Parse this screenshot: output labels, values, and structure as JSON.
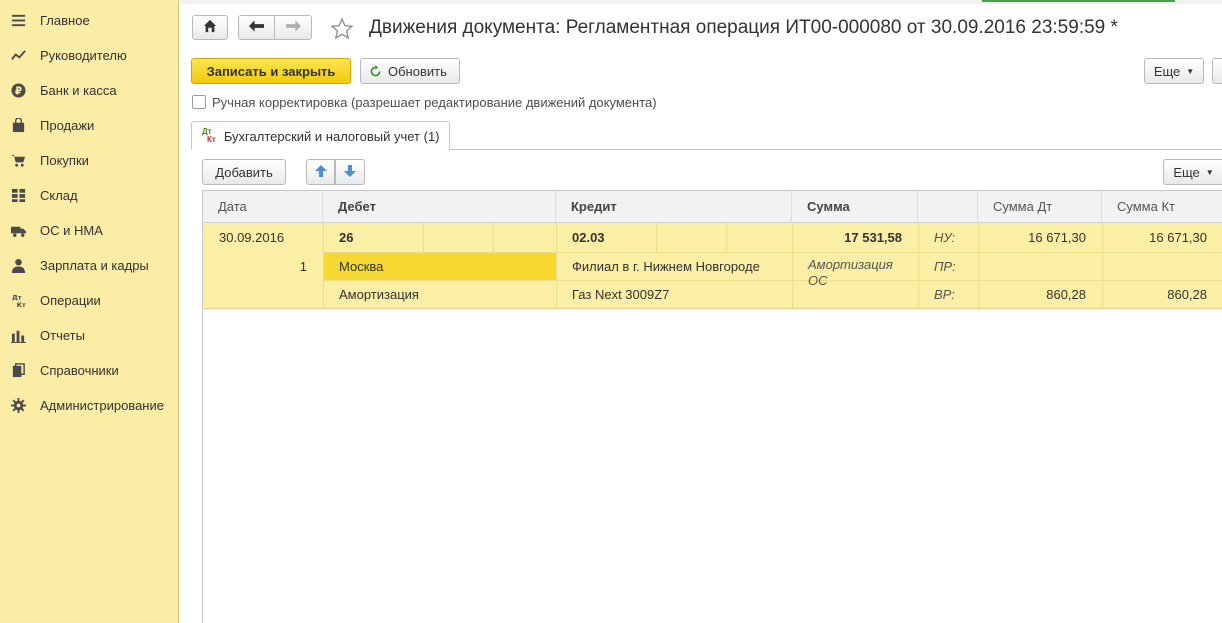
{
  "sidebar": {
    "items": [
      {
        "label": "Главное",
        "icon": "menu-icon"
      },
      {
        "label": "Руководителю",
        "icon": "trend-icon"
      },
      {
        "label": "Банк и касса",
        "icon": "ruble-icon"
      },
      {
        "label": "Продажи",
        "icon": "bag-icon"
      },
      {
        "label": "Покупки",
        "icon": "cart-icon"
      },
      {
        "label": "Склад",
        "icon": "grid-icon"
      },
      {
        "label": "ОС и НМА",
        "icon": "truck-icon"
      },
      {
        "label": "Зарплата и кадры",
        "icon": "person-icon"
      },
      {
        "label": "Операции",
        "icon": "dt-kt-icon"
      },
      {
        "label": "Отчеты",
        "icon": "bar-chart-icon"
      },
      {
        "label": "Справочники",
        "icon": "books-icon"
      },
      {
        "label": "Администрирование",
        "icon": "gear-icon"
      }
    ]
  },
  "header": {
    "title": "Движения документа: Регламентная операция ИТ00-000080 от 30.09.2016 23:59:59 *"
  },
  "toolbar": {
    "save_close_label": "Записать и закрыть",
    "refresh_label": "Обновить",
    "more_label": "Еще"
  },
  "manual_correction": {
    "label": "Ручная корректировка (разрешает редактирование движений документа)",
    "checked": false
  },
  "tab": {
    "icon_top": "Дт",
    "icon_bottom": "Кт",
    "label": "Бухгалтерский и налоговый учет (1)"
  },
  "table_toolbar": {
    "add_label": "Добавить",
    "more_label": "Еще"
  },
  "table": {
    "headers": {
      "date": "Дата",
      "debit": "Дебет",
      "credit": "Кредит",
      "sum": "Сумма",
      "sum_dt": "Сумма Дт",
      "sum_kt": "Сумма Кт"
    },
    "row": {
      "date": "30.09.2016",
      "number": "1",
      "debit_account": "26",
      "debit_sub1": "Москва",
      "debit_sub2": "Амортизация",
      "credit_account": "02.03",
      "credit_sub1": "Филиал в г. Нижнем Новгороде",
      "credit_sub2": "Газ Next 3009Z7",
      "sum": "17 531,58",
      "content": "Амортизация ОС",
      "nu_label": "НУ:",
      "pr_label": "ПР:",
      "vr_label": "ВР:",
      "nu_dt": "16 671,30",
      "nu_kt": "16 671,30",
      "vr_dt": "860,28",
      "vr_kt": "860,28"
    }
  },
  "colors": {
    "sidebar_bg": "#fbeca6",
    "row_bg": "#fbeea5",
    "row_selected": "#f6d830",
    "primary_button": "#f5d11a"
  }
}
